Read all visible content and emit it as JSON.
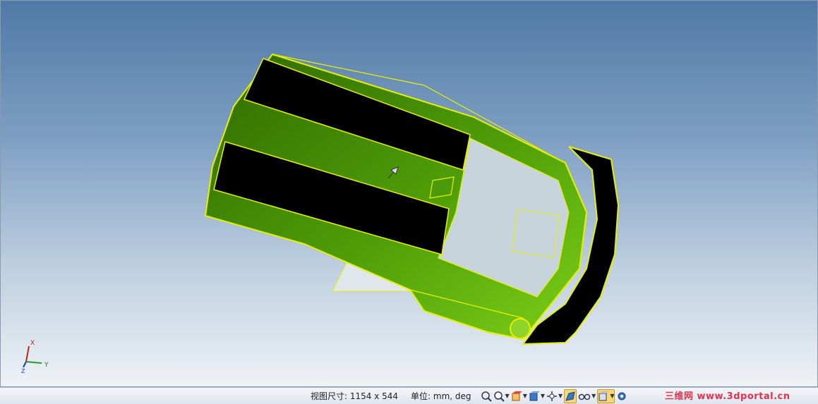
{
  "statusbar": {
    "viewport_size_label": "视图尺寸: 1154 x  544",
    "units_label": "单位: mm, deg"
  },
  "triad": {
    "x_label": "X",
    "y_label": "Y",
    "z_label": "Z"
  },
  "watermark": {
    "text": "三维网 www.3dportal.cn"
  },
  "colors": {
    "model_green": "#4a9a0a",
    "edge_yellow": "#e8f000",
    "stripe_black": "#000000",
    "glass": "#c8d4dc"
  },
  "icons": [
    "zoom-fit-icon",
    "zoom-icon",
    "view-orient-icon",
    "standard-views-icon",
    "pan-rotate-icon",
    "shaded-display-icon",
    "visibility-icon",
    "display-mode-icon",
    "settings-icon"
  ]
}
